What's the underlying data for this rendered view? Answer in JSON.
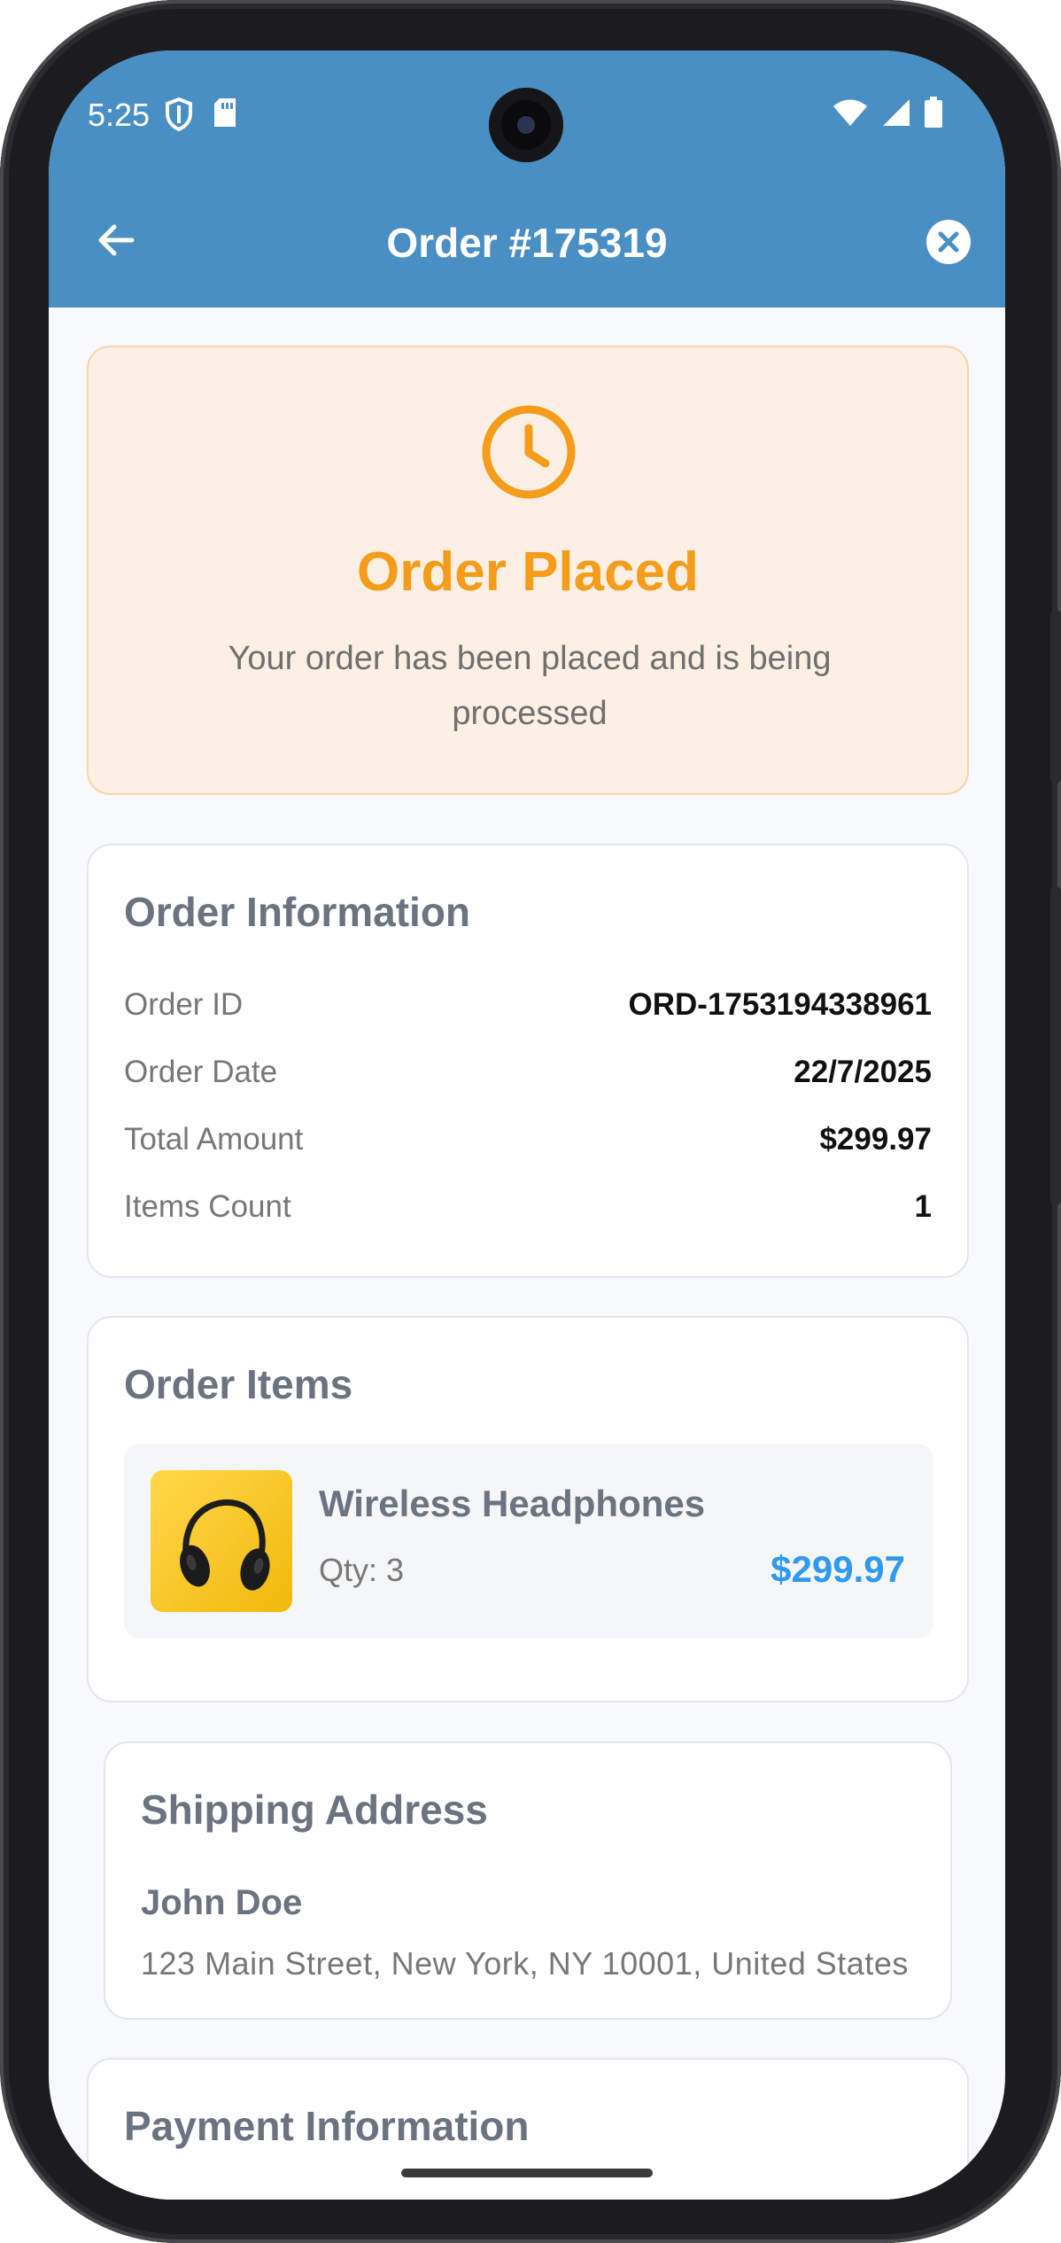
{
  "status_bar": {
    "time": "5:25",
    "left_icons": [
      "shield-icon",
      "sd-card-icon"
    ],
    "right_icons": [
      "wifi-icon",
      "signal-icon",
      "battery-icon"
    ]
  },
  "app_bar": {
    "title": "Order #175319",
    "back_icon": "arrow-left-icon",
    "close_icon": "close-circle-icon",
    "background_color": "#4a8fc4"
  },
  "order_status": {
    "icon": "clock-icon",
    "title": "Order Placed",
    "message": "Your order has been placed and is being processed",
    "accent_color": "#f59c1a"
  },
  "order_information": {
    "title": "Order Information",
    "rows": [
      {
        "label": "Order ID",
        "value": "ORD-1753194338961"
      },
      {
        "label": "Order Date",
        "value": "22/7/2025"
      },
      {
        "label": "Total Amount",
        "value": "$299.97"
      },
      {
        "label": "Items Count",
        "value": "1"
      }
    ]
  },
  "order_items": {
    "title": "Order Items",
    "items": [
      {
        "name": "Wireless Headphones",
        "qty": "Qty: 3",
        "price": "$299.97",
        "image": "headphones-image"
      }
    ],
    "price_color": "#2f9af0"
  },
  "shipping_address": {
    "title": "Shipping Address",
    "name": "John Doe",
    "address": "123 Main Street, New York, NY 10001, United States"
  },
  "payment_information": {
    "title": "Payment Information"
  }
}
